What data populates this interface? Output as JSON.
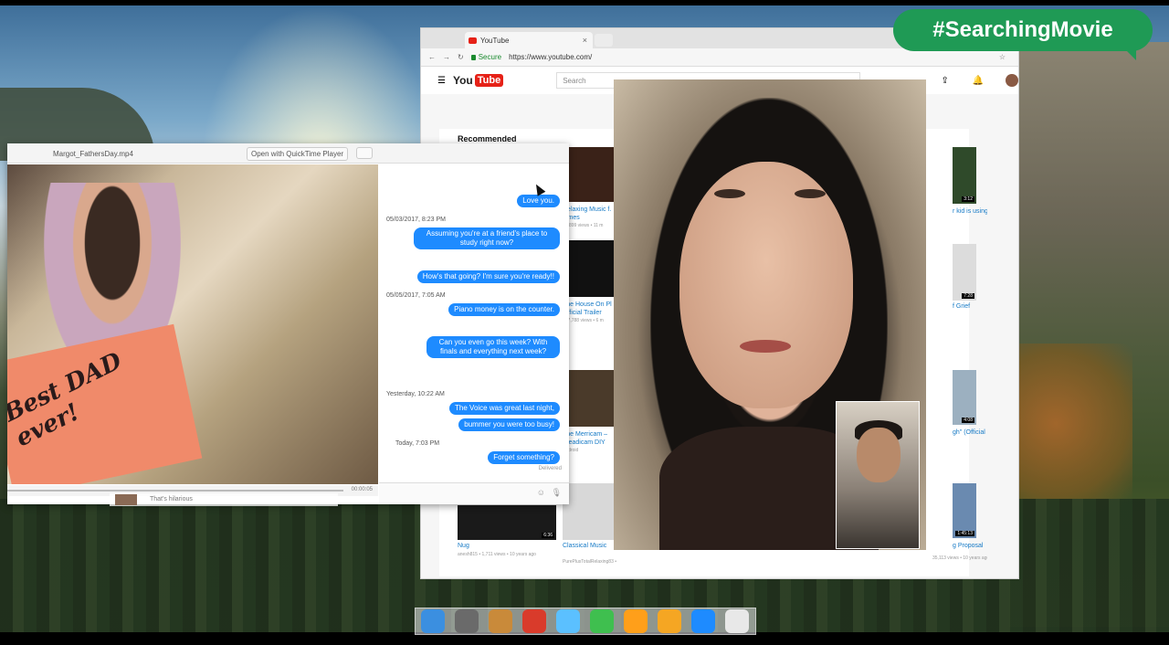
{
  "overlay": {
    "hashtag": "#SearchingMovie"
  },
  "browser": {
    "tab_title": "YouTube",
    "tab_close": "×",
    "secure_label": "Secure",
    "url": "https://www.youtube.com/",
    "bookmark_star": "☆",
    "youtube": {
      "logo_you": "You",
      "logo_tube": "Tube",
      "search_placeholder": "Search",
      "recommended_label": "Recommended",
      "videos": [
        {
          "title": "Relaxing Music f. Times",
          "meta": "21,899 views • 11 m",
          "duration": ""
        },
        {
          "title": "The House On Pl Official Trailer",
          "meta": "277,788 views • 6 m",
          "duration": ""
        },
        {
          "title": "The Merricam – Steadicam DIY",
          "meta": "Android",
          "duration": ""
        },
        {
          "title": "Classical Music",
          "meta": "PurePlusTotalRelaxing83 • 40,237 views • 10 years ago",
          "duration": ""
        },
        {
          "title": "Nug",
          "meta": "anesh815 • 1,711 views • 10 years ago",
          "duration": "6:36"
        },
        {
          "title": "r kid is using",
          "meta": "",
          "duration": "3:12"
        },
        {
          "title": "f Grief",
          "meta": "",
          "duration": "7:28"
        },
        {
          "title": "gh\" (Official",
          "meta": "",
          "duration": "4:08"
        },
        {
          "title": "g Proposal",
          "meta": "35,113 views • 10 years ago",
          "duration": "1:45:13"
        }
      ]
    }
  },
  "quicktime": {
    "filename": "Margot_FathersDay.mp4",
    "open_button": "Open with QuickTime Player",
    "timecode": "00:00:05",
    "card_text": "Best DAD ever!"
  },
  "messages": [
    {
      "kind": "bubble",
      "text": "Love you."
    },
    {
      "kind": "stamp",
      "text": "05/03/2017, 8:23 PM"
    },
    {
      "kind": "bubble",
      "text": "Assuming you're at a friend's place to study right now?"
    },
    {
      "kind": "bubble",
      "text": "How's that going? I'm sure you're ready!!"
    },
    {
      "kind": "stamp",
      "text": "05/05/2017, 7:05 AM"
    },
    {
      "kind": "bubble",
      "text": "Piano money is on the counter."
    },
    {
      "kind": "bubble",
      "text": "Can you even go this week? With finals and everything next week?"
    },
    {
      "kind": "stamp",
      "text": "Yesterday, 10:22 AM"
    },
    {
      "kind": "bubble",
      "text": "The Voice was great last night,"
    },
    {
      "kind": "bubble",
      "text": "bummer you were too busy!"
    },
    {
      "kind": "stamp",
      "text": "Today, 7:03 PM"
    },
    {
      "kind": "bubble",
      "text": "Forget something?"
    },
    {
      "kind": "status",
      "text": "Delivered"
    }
  ],
  "chat_snippet": "That's hilarious",
  "dock": {
    "apps": [
      "Finder",
      "System Preferences",
      "Notes",
      "Chrome",
      "Messages",
      "FaceTime",
      "Photos",
      "Calendar",
      "App Store",
      "Trash"
    ],
    "colors": [
      "#3b8fe0",
      "#6a6a6a",
      "#c98a3a",
      "#d93b2b",
      "#5bc0ff",
      "#3fbf4f",
      "#ff9f1a",
      "#f5a623",
      "#1e8bff",
      "#e8e8e8"
    ]
  }
}
